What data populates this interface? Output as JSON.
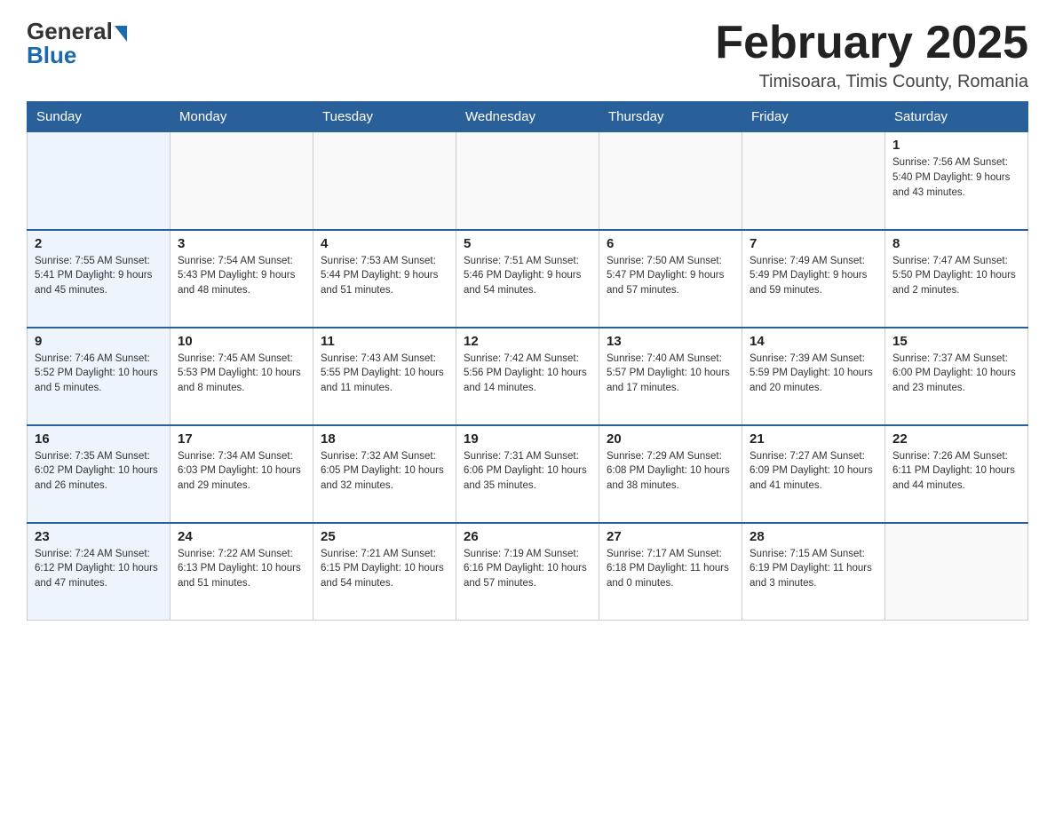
{
  "header": {
    "logo_general": "General",
    "logo_blue": "Blue",
    "month_title": "February 2025",
    "location": "Timisoara, Timis County, Romania"
  },
  "weekdays": [
    "Sunday",
    "Monday",
    "Tuesday",
    "Wednesday",
    "Thursday",
    "Friday",
    "Saturday"
  ],
  "rows": [
    [
      {
        "day": "",
        "info": ""
      },
      {
        "day": "",
        "info": ""
      },
      {
        "day": "",
        "info": ""
      },
      {
        "day": "",
        "info": ""
      },
      {
        "day": "",
        "info": ""
      },
      {
        "day": "",
        "info": ""
      },
      {
        "day": "1",
        "info": "Sunrise: 7:56 AM\nSunset: 5:40 PM\nDaylight: 9 hours\nand 43 minutes."
      }
    ],
    [
      {
        "day": "2",
        "info": "Sunrise: 7:55 AM\nSunset: 5:41 PM\nDaylight: 9 hours\nand 45 minutes."
      },
      {
        "day": "3",
        "info": "Sunrise: 7:54 AM\nSunset: 5:43 PM\nDaylight: 9 hours\nand 48 minutes."
      },
      {
        "day": "4",
        "info": "Sunrise: 7:53 AM\nSunset: 5:44 PM\nDaylight: 9 hours\nand 51 minutes."
      },
      {
        "day": "5",
        "info": "Sunrise: 7:51 AM\nSunset: 5:46 PM\nDaylight: 9 hours\nand 54 minutes."
      },
      {
        "day": "6",
        "info": "Sunrise: 7:50 AM\nSunset: 5:47 PM\nDaylight: 9 hours\nand 57 minutes."
      },
      {
        "day": "7",
        "info": "Sunrise: 7:49 AM\nSunset: 5:49 PM\nDaylight: 9 hours\nand 59 minutes."
      },
      {
        "day": "8",
        "info": "Sunrise: 7:47 AM\nSunset: 5:50 PM\nDaylight: 10 hours\nand 2 minutes."
      }
    ],
    [
      {
        "day": "9",
        "info": "Sunrise: 7:46 AM\nSunset: 5:52 PM\nDaylight: 10 hours\nand 5 minutes."
      },
      {
        "day": "10",
        "info": "Sunrise: 7:45 AM\nSunset: 5:53 PM\nDaylight: 10 hours\nand 8 minutes."
      },
      {
        "day": "11",
        "info": "Sunrise: 7:43 AM\nSunset: 5:55 PM\nDaylight: 10 hours\nand 11 minutes."
      },
      {
        "day": "12",
        "info": "Sunrise: 7:42 AM\nSunset: 5:56 PM\nDaylight: 10 hours\nand 14 minutes."
      },
      {
        "day": "13",
        "info": "Sunrise: 7:40 AM\nSunset: 5:57 PM\nDaylight: 10 hours\nand 17 minutes."
      },
      {
        "day": "14",
        "info": "Sunrise: 7:39 AM\nSunset: 5:59 PM\nDaylight: 10 hours\nand 20 minutes."
      },
      {
        "day": "15",
        "info": "Sunrise: 7:37 AM\nSunset: 6:00 PM\nDaylight: 10 hours\nand 23 minutes."
      }
    ],
    [
      {
        "day": "16",
        "info": "Sunrise: 7:35 AM\nSunset: 6:02 PM\nDaylight: 10 hours\nand 26 minutes."
      },
      {
        "day": "17",
        "info": "Sunrise: 7:34 AM\nSunset: 6:03 PM\nDaylight: 10 hours\nand 29 minutes."
      },
      {
        "day": "18",
        "info": "Sunrise: 7:32 AM\nSunset: 6:05 PM\nDaylight: 10 hours\nand 32 minutes."
      },
      {
        "day": "19",
        "info": "Sunrise: 7:31 AM\nSunset: 6:06 PM\nDaylight: 10 hours\nand 35 minutes."
      },
      {
        "day": "20",
        "info": "Sunrise: 7:29 AM\nSunset: 6:08 PM\nDaylight: 10 hours\nand 38 minutes."
      },
      {
        "day": "21",
        "info": "Sunrise: 7:27 AM\nSunset: 6:09 PM\nDaylight: 10 hours\nand 41 minutes."
      },
      {
        "day": "22",
        "info": "Sunrise: 7:26 AM\nSunset: 6:11 PM\nDaylight: 10 hours\nand 44 minutes."
      }
    ],
    [
      {
        "day": "23",
        "info": "Sunrise: 7:24 AM\nSunset: 6:12 PM\nDaylight: 10 hours\nand 47 minutes."
      },
      {
        "day": "24",
        "info": "Sunrise: 7:22 AM\nSunset: 6:13 PM\nDaylight: 10 hours\nand 51 minutes."
      },
      {
        "day": "25",
        "info": "Sunrise: 7:21 AM\nSunset: 6:15 PM\nDaylight: 10 hours\nand 54 minutes."
      },
      {
        "day": "26",
        "info": "Sunrise: 7:19 AM\nSunset: 6:16 PM\nDaylight: 10 hours\nand 57 minutes."
      },
      {
        "day": "27",
        "info": "Sunrise: 7:17 AM\nSunset: 6:18 PM\nDaylight: 11 hours\nand 0 minutes."
      },
      {
        "day": "28",
        "info": "Sunrise: 7:15 AM\nSunset: 6:19 PM\nDaylight: 11 hours\nand 3 minutes."
      },
      {
        "day": "",
        "info": ""
      }
    ]
  ]
}
